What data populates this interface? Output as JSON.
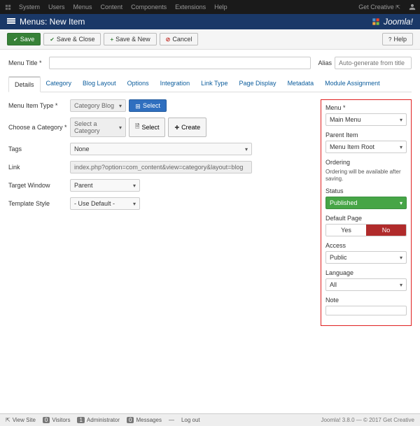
{
  "topbar": {
    "menus": [
      "System",
      "Users",
      "Menus",
      "Content",
      "Components",
      "Extensions",
      "Help"
    ],
    "right_label": "Get Creative"
  },
  "header": {
    "title": "Menus: New Item",
    "brand": "Joomla!"
  },
  "toolbar": {
    "save": "Save",
    "save_close": "Save & Close",
    "save_new": "Save & New",
    "cancel": "Cancel",
    "help": "Help"
  },
  "title_row": {
    "menu_title_label": "Menu Title *",
    "menu_title_value": "",
    "alias_label": "Alias",
    "alias_placeholder": "Auto-generate from title"
  },
  "tabs": [
    "Details",
    "Category",
    "Blog Layout",
    "Options",
    "Integration",
    "Link Type",
    "Page Display",
    "Metadata",
    "Module Assignment"
  ],
  "details": {
    "menu_item_type": {
      "label": "Menu Item Type *",
      "value": "Category Blog",
      "select_btn": "Select"
    },
    "choose_category": {
      "label": "Choose a Category *",
      "value": "Select a Category",
      "select_btn": "Select",
      "create_btn": "Create"
    },
    "tags": {
      "label": "Tags",
      "value": "None"
    },
    "link": {
      "label": "Link",
      "value": "index.php?option=com_content&view=category&layout=blog"
    },
    "target_window": {
      "label": "Target Window",
      "value": "Parent"
    },
    "template_style": {
      "label": "Template Style",
      "value": "- Use Default -"
    }
  },
  "sidebar": {
    "menu": {
      "label": "Menu *",
      "value": "Main Menu"
    },
    "parent": {
      "label": "Parent Item",
      "value": "Menu Item Root"
    },
    "ordering": {
      "label": "Ordering",
      "hint": "Ordering will be available after saving."
    },
    "status": {
      "label": "Status",
      "value": "Published"
    },
    "default_page": {
      "label": "Default Page",
      "yes": "Yes",
      "no": "No"
    },
    "access": {
      "label": "Access",
      "value": "Public"
    },
    "language": {
      "label": "Language",
      "value": "All"
    },
    "note": {
      "label": "Note"
    }
  },
  "footer": {
    "view_site": "View Site",
    "visitors": {
      "count": "0",
      "label": "Visitors"
    },
    "admin": {
      "count": "1",
      "label": "Administrator"
    },
    "messages": {
      "count": "0",
      "label": "Messages"
    },
    "logout": "Log out",
    "right": "Joomla! 3.8.0 — © 2017 Get Creative"
  }
}
